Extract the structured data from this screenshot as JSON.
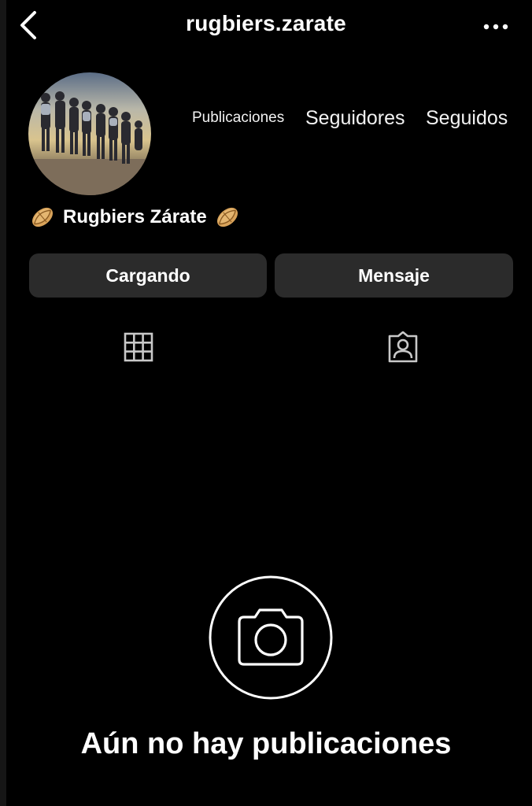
{
  "header": {
    "username": "rugbiers.zarate",
    "back_icon": "chevron-left-icon",
    "more_icon": "more-horizontal-icon"
  },
  "profile": {
    "avatar_icon": "group-photo-avatar",
    "stats": {
      "publicaciones_label": "Publicaciones",
      "seguidores_label": "Seguidores",
      "seguidos_label": "Seguidos"
    },
    "display_name": "Rugbiers Zárate",
    "name_emoji": "rugby-ball-icon"
  },
  "actions": {
    "loading_label": "Cargando",
    "message_label": "Mensaje"
  },
  "tabs": [
    {
      "icon": "grid-icon"
    },
    {
      "icon": "tagged-person-icon"
    }
  ],
  "empty_state": {
    "icon": "camera-icon",
    "text": "Aún no hay publicaciones"
  },
  "colors": {
    "background": "#000000",
    "button_bg": "#2b2b2b",
    "text": "#ffffff"
  }
}
